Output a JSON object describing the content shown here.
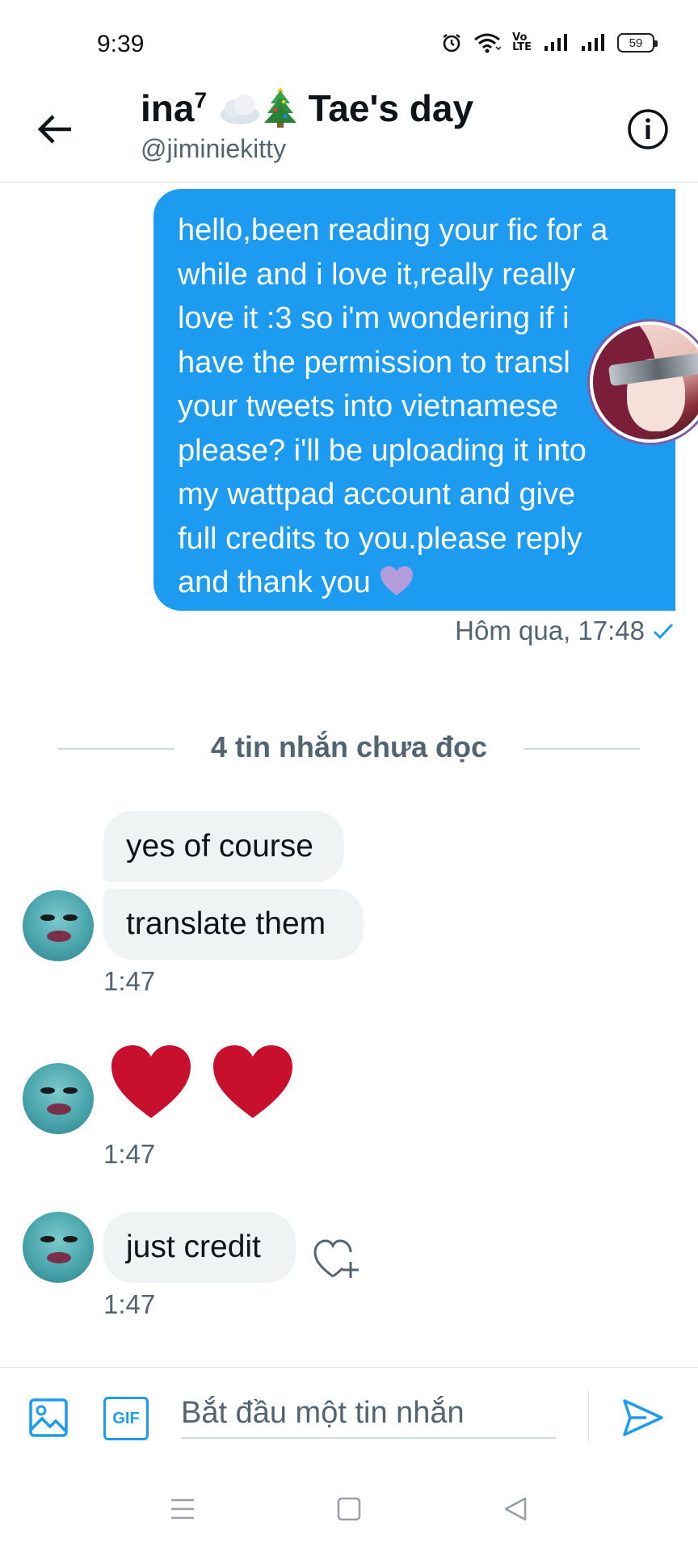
{
  "status_bar": {
    "time": "9:39",
    "volte_line1": "Vo",
    "volte_line2": "LTE",
    "battery": "59"
  },
  "header": {
    "title_name": "ina",
    "title_sup": "7",
    "title_suffix": "Tae's day",
    "handle": "@jiminiekitty",
    "title_emojis": [
      "cloud",
      "christmas-tree"
    ]
  },
  "messages": {
    "sent": {
      "text": "hello,been reading your fic for a while and i love it,really really love it :3 so i'm wondering if i have the permission to transl your tweets into vietnamese please? i'll be uploading it into my wattpad account and give full credits to you.please reply and thank you",
      "lines": [
        "hello,been reading your fic for a",
        "while and i love it,really really",
        "love it :3 so i'm wondering if i",
        "have the permission to transl",
        "your tweets into vietnamese",
        "please? i'll be uploading it into",
        "my wattpad account and give",
        "full credits to you.please reply",
        "and thank you"
      ],
      "emoji": "purple-heart",
      "timestamp": "Hôm qua, 17:48",
      "status_icon": "check-icon"
    },
    "unread_divider": "4 tin nhắn chưa đọc",
    "received": [
      {
        "text": "yes of course"
      },
      {
        "text": "translate them",
        "time": "1:47"
      },
      {
        "emoji": "red-heart x2",
        "time": "1:47"
      },
      {
        "text": "just credit",
        "time": "1:47"
      }
    ]
  },
  "colors": {
    "accent": "#1d9bf0",
    "received_bubble": "#eff3f4",
    "secondary_text": "#536471",
    "heart": "#c8102e"
  },
  "composer": {
    "placeholder": "Bắt đầu một tin nhắn",
    "gif_label": "GIF"
  }
}
